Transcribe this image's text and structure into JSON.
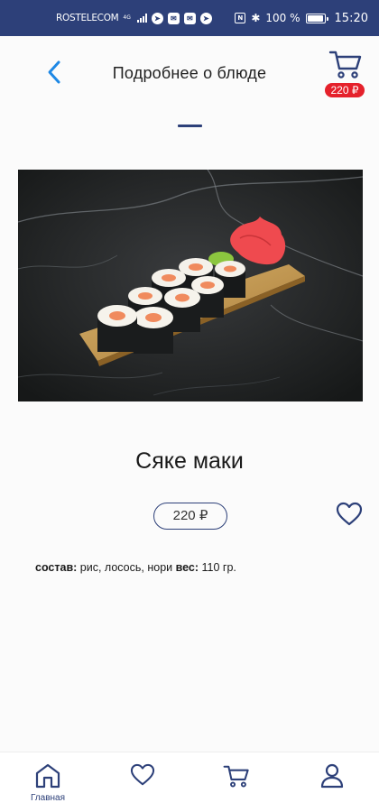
{
  "status_bar": {
    "carrier": "ROSTELECOM",
    "network": "4G",
    "battery": "100 %",
    "time": "15:20"
  },
  "header": {
    "title": "Подробнее о блюде",
    "cart_total": "220 ₽"
  },
  "dish": {
    "name": "Сяке маки",
    "price": "220 ₽",
    "composition_label": "состав:",
    "composition_value": " рис, лосось, нори ",
    "weight_label": "вес:",
    "weight_value": " 110 гр."
  },
  "bottom_nav": {
    "home_label": "Главная"
  },
  "colors": {
    "accent": "#2d4079",
    "badge": "#e5212b",
    "back_arrow": "#1e88e5"
  }
}
